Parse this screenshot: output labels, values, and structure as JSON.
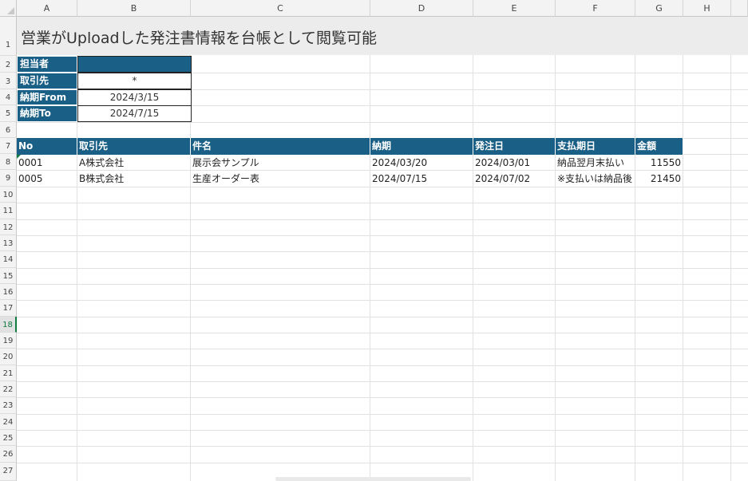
{
  "columns": [
    "A",
    "B",
    "C",
    "D",
    "E",
    "F",
    "G",
    "H"
  ],
  "rows": [
    "1",
    "2",
    "3",
    "4",
    "5",
    "6",
    "7",
    "8",
    "9",
    "10",
    "11",
    "12",
    "13",
    "14",
    "15",
    "16",
    "17",
    "18",
    "19",
    "20",
    "21",
    "22",
    "23",
    "24",
    "25",
    "26",
    "27"
  ],
  "title": "営業がUploadした発注書情報を台帳として閲覧可能",
  "filters": {
    "tantou_label": "担当者",
    "tantou_value": "",
    "torihiki_label": "取引先",
    "torihiki_value": "*",
    "noukifrom_label": "納期From",
    "noukifrom_value": "2024/3/15",
    "noukito_label": "納期To",
    "noukito_value": "2024/7/15"
  },
  "table": {
    "headers": [
      "No",
      "取引先",
      "件名",
      "納期",
      "発注日",
      "支払期日",
      "金額"
    ],
    "rows": [
      [
        "0001",
        "A株式会社",
        "展示会サンプル",
        "2024/03/20",
        "2024/03/01",
        "納品翌月末払い",
        "11550"
      ],
      [
        "0005",
        "B株式会社",
        "生産オーダー表",
        "2024/07/15",
        "2024/07/02",
        "※支払いは納品後",
        "21450"
      ]
    ]
  },
  "colors": {
    "header_fill": "#1a5f86",
    "selected_row": "#107c41"
  },
  "selected_row": "18"
}
